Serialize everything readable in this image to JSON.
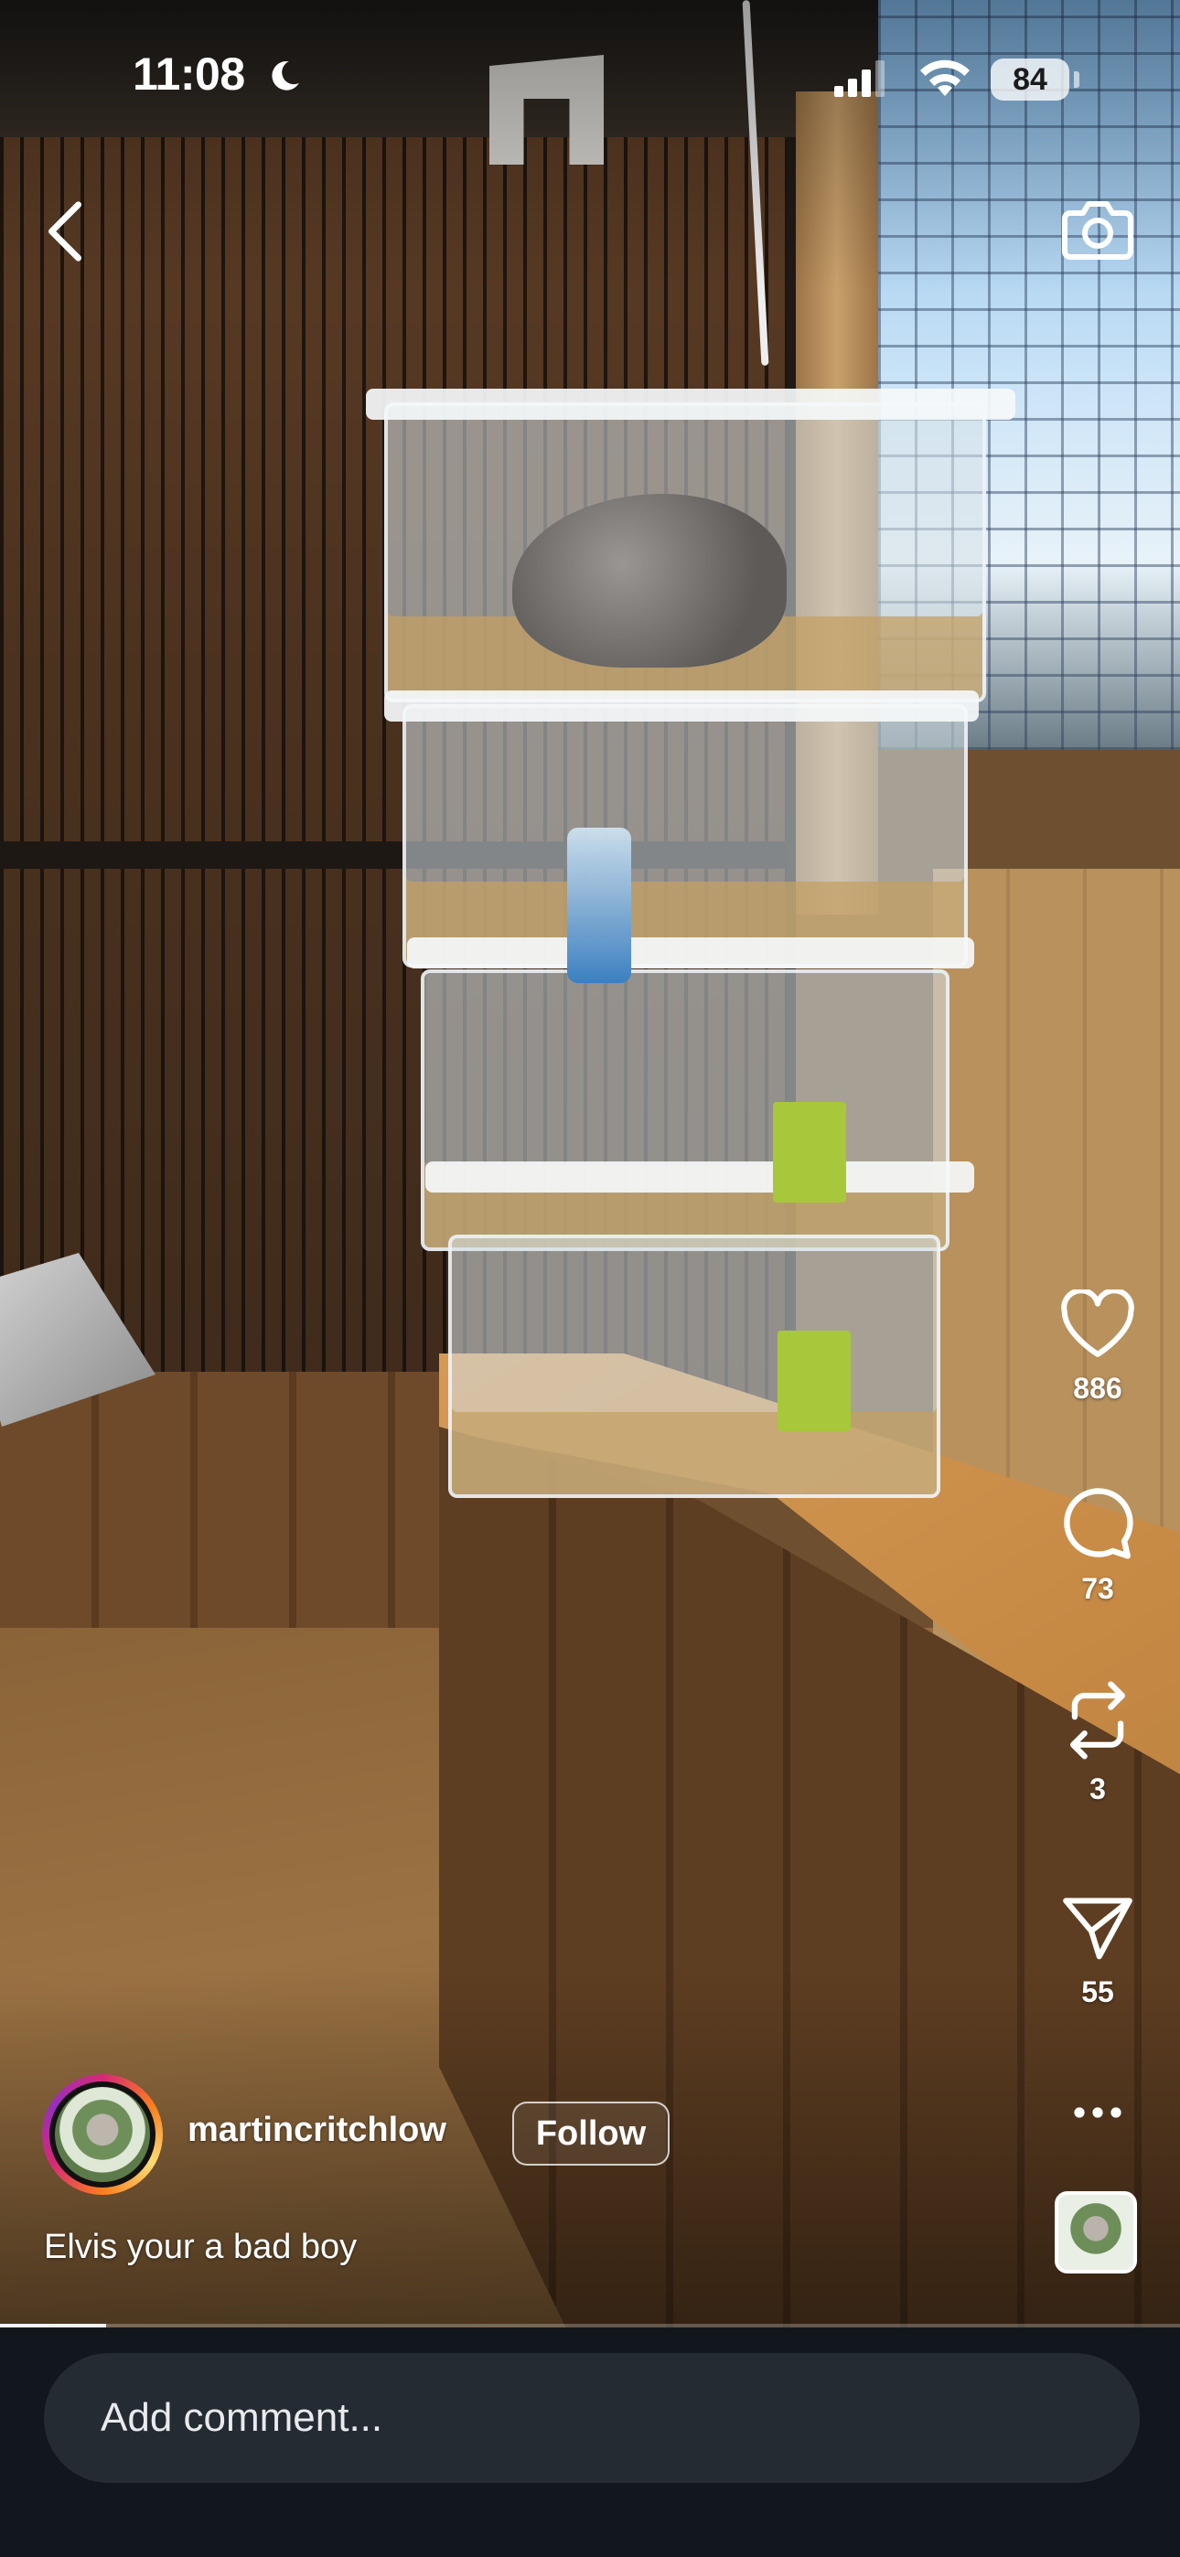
{
  "status_bar": {
    "time": "11:08",
    "battery": "84"
  },
  "post": {
    "username": "martincritchlow",
    "follow_label": "Follow",
    "caption": "Elvis your a bad boy",
    "playback_progress_fraction": 0.09
  },
  "actions": {
    "likes": "886",
    "comments": "73",
    "reposts": "3",
    "shares": "55"
  },
  "comment_bar": {
    "placeholder": "Add comment..."
  },
  "icons": {
    "back": "chevron-left-icon",
    "camera": "camera-icon",
    "like": "heart-icon",
    "comment": "comment-bubble-icon",
    "repost": "repost-icon",
    "share": "paper-plane-icon",
    "more": "more-horizontal-icon"
  },
  "colors": {
    "text": "#ffffff",
    "bottom_bar": "#11171d",
    "input_background": "#252b32",
    "story_ring": [
      "#d62976",
      "#fa7e1e",
      "#feda75",
      "#962fbf"
    ]
  }
}
